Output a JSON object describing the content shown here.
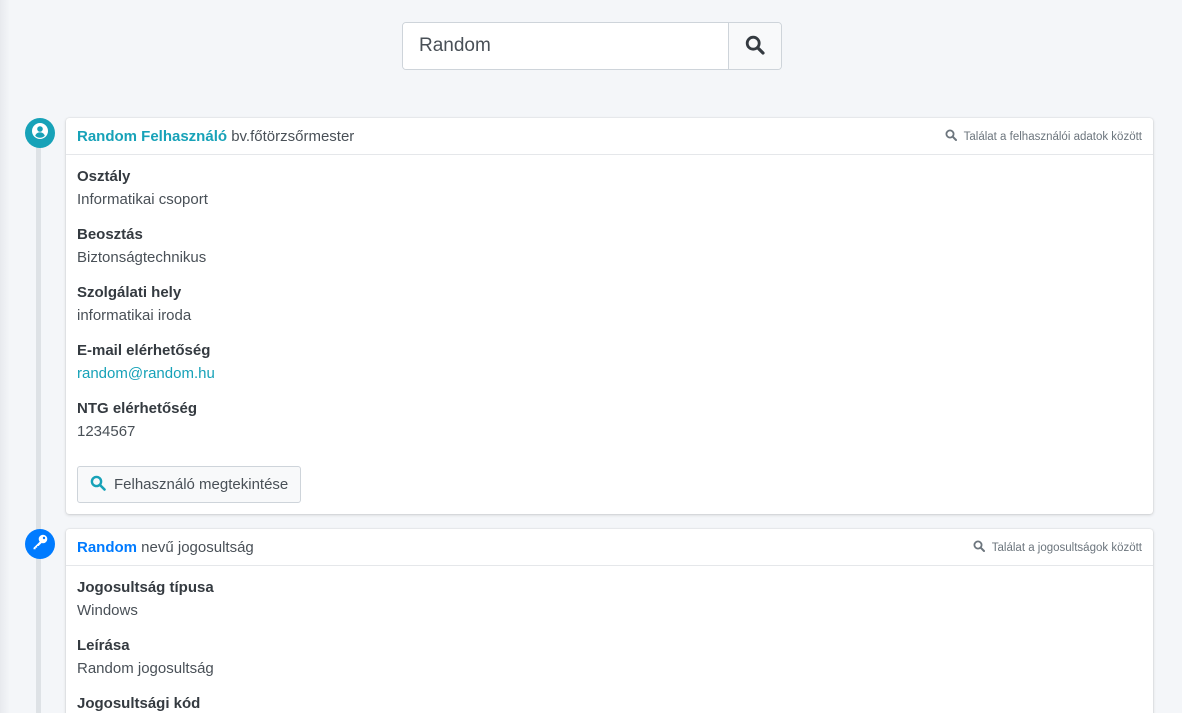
{
  "search": {
    "value": "Random",
    "button_icon": "search-icon"
  },
  "user_result": {
    "icon": "user-circle-icon",
    "name": "Random Felhasználó",
    "rank": "bv.főtörzsőrmester",
    "hint": "Találat a felhasználói adatok között",
    "fields": [
      {
        "label": "Osztály",
        "value": "Informatikai csoport"
      },
      {
        "label": "Beosztás",
        "value": "Biztonságtechnikus"
      },
      {
        "label": "Szolgálati hely",
        "value": "informatikai iroda"
      },
      {
        "label": "E-mail elérhetőség",
        "value": "random@random.hu"
      },
      {
        "label": "NTG elérhetőség",
        "value": "1234567"
      }
    ],
    "view_button": "Felhasználó megtekintése"
  },
  "permission_result": {
    "icon": "key-icon",
    "name": "Random",
    "suffix": "nevű jogosultság",
    "hint": "Találat a jogosultságok között",
    "fields": [
      {
        "label": "Jogosultság típusa",
        "value": "Windows"
      },
      {
        "label": "Leírása",
        "value": "Random jogosultság"
      },
      {
        "label": "Jogosultsági kód",
        "value": ""
      }
    ]
  },
  "colors": {
    "teal": "#17a2b8",
    "blue": "#007bff",
    "background": "#f4f6f9"
  }
}
